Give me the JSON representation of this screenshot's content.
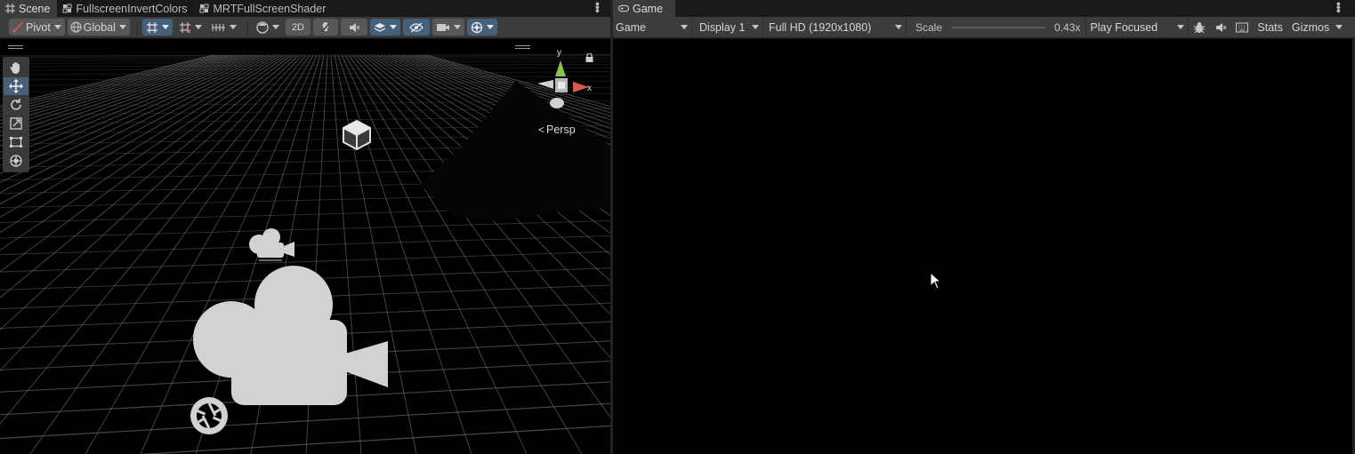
{
  "scene_panel": {
    "tabs": [
      {
        "label": "Scene",
        "icon": "scene-hash-icon",
        "active": true
      },
      {
        "label": "FullscreenInvertColors",
        "icon": "shader-graph-icon",
        "active": false
      },
      {
        "label": "MRTFullScreenShader",
        "icon": "shader-graph-icon",
        "active": false
      }
    ],
    "toolbar": {
      "pivot_label": "Pivot",
      "global_label": "Global",
      "mode_2d_label": "2D"
    },
    "tools": [
      "hand-tool-icon",
      "move-tool-icon",
      "rotate-tool-icon",
      "scale-tool-icon",
      "rect-tool-icon",
      "transform-tool-icon"
    ],
    "gizmo": {
      "y_label": "y",
      "x_label": "x"
    },
    "persp_label": "Persp"
  },
  "game_panel": {
    "tab": {
      "label": "Game",
      "icon": "gamepad-icon"
    },
    "toolbar": {
      "view_dropdown": "Game",
      "display_dropdown": "Display 1",
      "resolution_dropdown": "Full HD (1920x1080)",
      "scale_label": "Scale",
      "scale_value": "0.43x",
      "play_mode_dropdown": "Play Focused",
      "stats_label": "Stats",
      "gizmos_label": "Gizmos"
    }
  },
  "colors": {
    "panel_bg": "#3c3c3c",
    "active_blue": "#46607c",
    "view_bg": "#000000",
    "axis_y": "#8cc251",
    "axis_x": "#d85a4a"
  }
}
